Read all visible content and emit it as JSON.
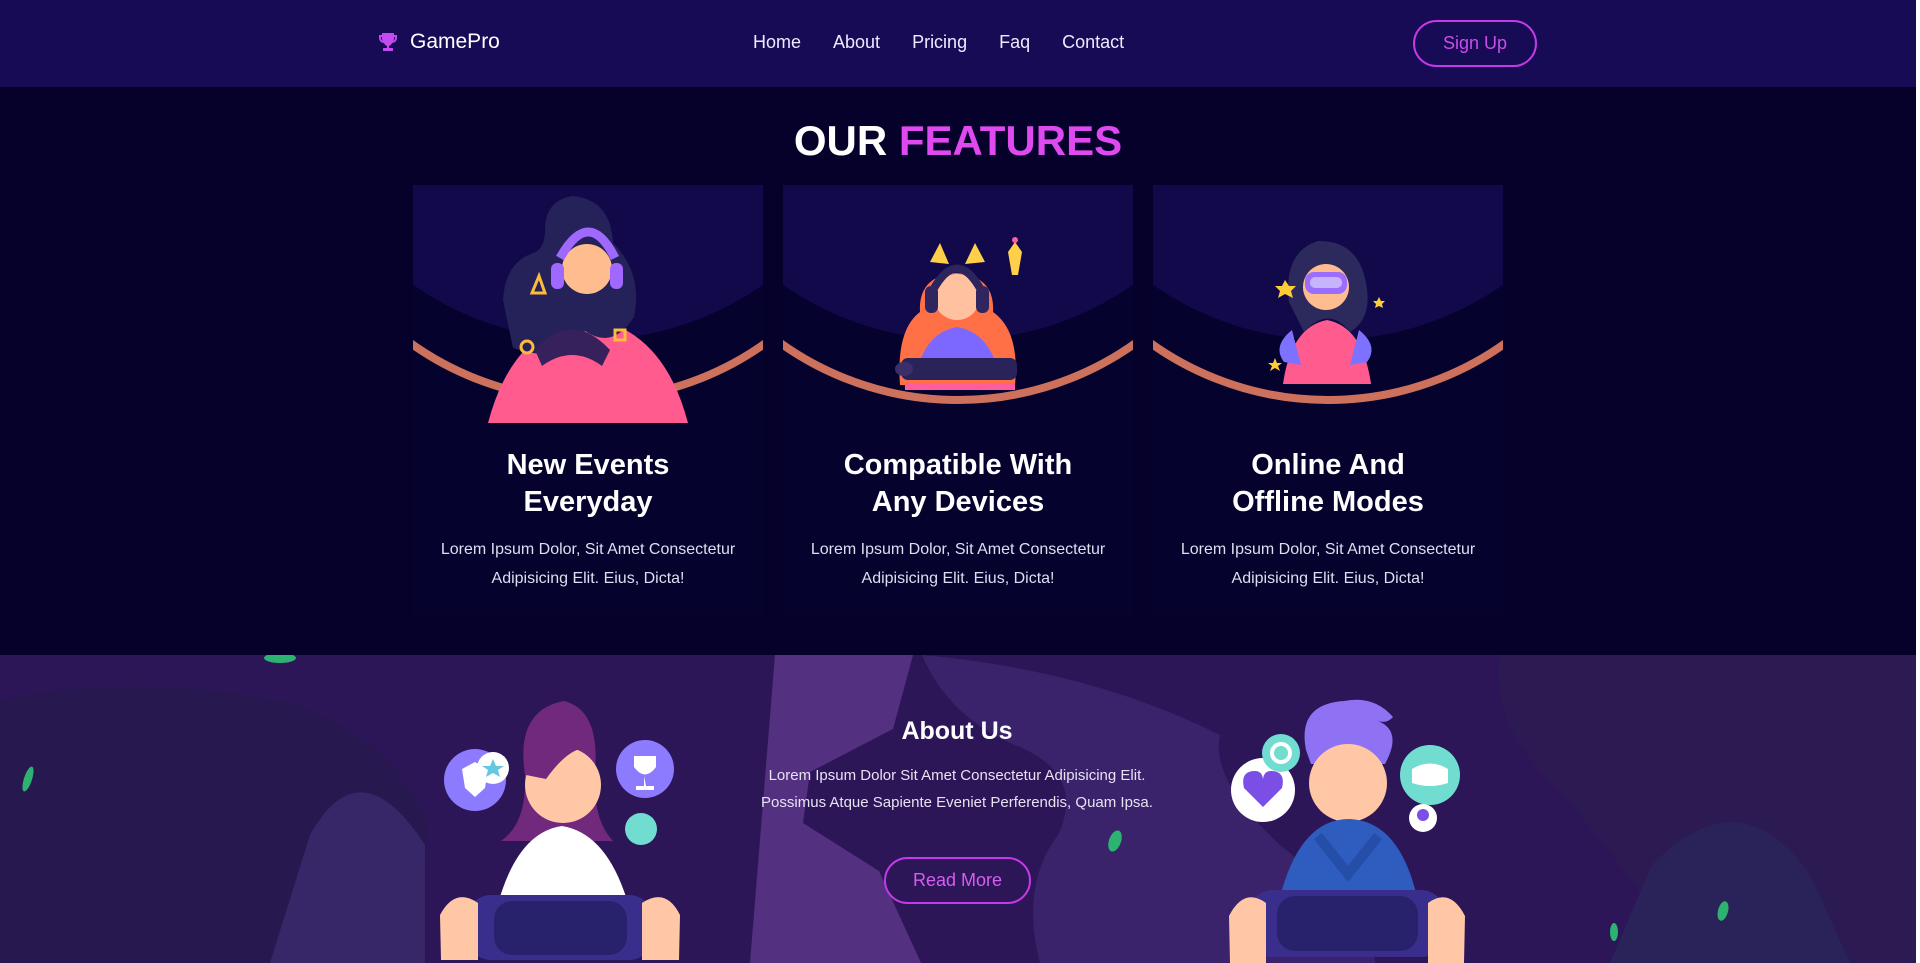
{
  "nav": {
    "logo_text": "GamePro",
    "logo_icon": "trophy-icon",
    "links": [
      "Home",
      "About",
      "Pricing",
      "Faq",
      "Contact"
    ],
    "signup_label": "Sign Up"
  },
  "features": {
    "title_prefix": "OUR",
    "title_accent": "FEATURES",
    "cards": [
      {
        "title_line1": "New Events",
        "title_line2": "Everyday",
        "text": "Lorem Ipsum Dolor, Sit Amet Consectetur Adipisicing Elit. Eius, Dicta!",
        "illustration": "gamer-with-headset-icon"
      },
      {
        "title_line1": "Compatible With",
        "title_line2": "Any Devices",
        "text": "Lorem Ipsum Dolor, Sit Amet Consectetur Adipisicing Elit. Eius, Dicta!",
        "illustration": "gamer-at-keyboard-icon"
      },
      {
        "title_line1": "Online And",
        "title_line2": "Offline Modes",
        "text": "Lorem Ipsum Dolor, Sit Amet Consectetur Adipisicing Elit. Eius, Dicta!",
        "illustration": "vr-gamer-icon"
      }
    ]
  },
  "about": {
    "title": "About Us",
    "text": "Lorem Ipsum Dolor Sit Amet Consectetur Adipisicing Elit. Possimus Atque Sapiente Eveniet Perferendis, Quam Ipsa.",
    "button_label": "Read More"
  },
  "colors": {
    "nav_background": "#170b55",
    "page_background": "#05012a",
    "accent": "#df49f0",
    "about_background": "#2c1756"
  }
}
